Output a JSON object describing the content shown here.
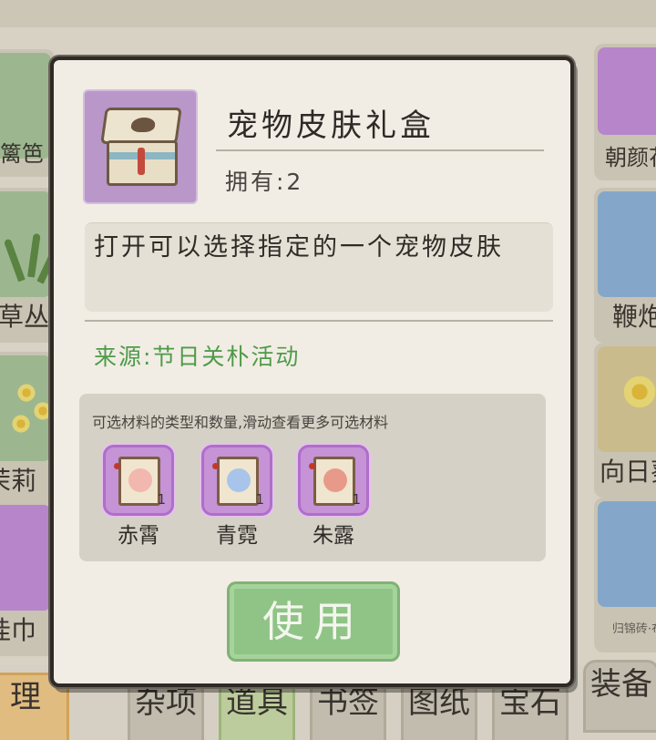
{
  "background": {
    "left_column": [
      {
        "name": "伞篱笆"
      },
      {
        "name": "芥草丛"
      },
      {
        "name": "茉莉"
      },
      {
        "name": "挂巾"
      }
    ],
    "right_column": [
      {
        "name": "朝颜花"
      },
      {
        "name": "鞭炮"
      },
      {
        "name": "向日葵"
      },
      {
        "name": "归锦砖·布"
      }
    ],
    "tabs": [
      "理",
      "杂项",
      "道具",
      "书签",
      "图纸",
      "宝石",
      "装备"
    ]
  },
  "modal": {
    "item_name": "宠物皮肤礼盒",
    "owned": "拥有:2",
    "description": "打开可以选择指定的一个宠物皮肤",
    "source": "来源:节日关朴活动",
    "materials_hint": "可选材料的类型和数量,滑动查看更多可选材料",
    "materials": [
      {
        "name": "赤霄",
        "count": "1",
        "face_color": "#f2b8b0"
      },
      {
        "name": "青霓",
        "count": "1",
        "face_color": "#a9c4ea"
      },
      {
        "name": "朱露",
        "count": "1",
        "face_color": "#e89a8a"
      }
    ],
    "use_button": "使用"
  },
  "colors": {
    "source_green": "#4f9a4a",
    "use_button": "#8fc486",
    "item_icon_bg": "#b997c9",
    "material_card": "#c593d6"
  },
  "icons": {
    "item_icon": "gift-box-icon",
    "material_icon": "pet-portrait-scroll-icon"
  }
}
